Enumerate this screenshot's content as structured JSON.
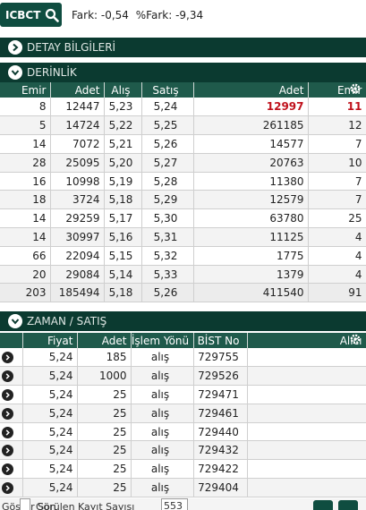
{
  "toolbar": {
    "symbol": "ICBCT",
    "fark": "Fark: -0,54",
    "pct_fark": "%Fark: -9,34"
  },
  "panels": {
    "detay": "DETAY BİLGİLERİ",
    "derinlik": "DERİNLİK",
    "zaman": "ZAMAN / SATIŞ"
  },
  "depth": {
    "headers": [
      "Emir",
      "Adet",
      "Alış",
      "Satış",
      "Adet",
      "Emir"
    ],
    "rows": [
      [
        "8",
        "12447",
        "5,23",
        "5,24",
        "12997",
        "11"
      ],
      [
        "5",
        "14724",
        "5,22",
        "5,25",
        "261185",
        "12"
      ],
      [
        "14",
        "7072",
        "5,21",
        "5,26",
        "14577",
        "7"
      ],
      [
        "28",
        "25095",
        "5,20",
        "5,27",
        "20763",
        "10"
      ],
      [
        "16",
        "10998",
        "5,19",
        "5,28",
        "11380",
        "7"
      ],
      [
        "18",
        "3724",
        "5,18",
        "5,29",
        "12579",
        "7"
      ],
      [
        "14",
        "29259",
        "5,17",
        "5,30",
        "63780",
        "25"
      ],
      [
        "14",
        "30997",
        "5,16",
        "5,31",
        "11125",
        "4"
      ],
      [
        "66",
        "22094",
        "5,15",
        "5,32",
        "1775",
        "4"
      ],
      [
        "20",
        "29084",
        "5,14",
        "5,33",
        "1379",
        "4"
      ]
    ],
    "total": [
      "203",
      "185494",
      "5,18",
      "5,26",
      "411540",
      "91"
    ]
  },
  "trades": {
    "headers": [
      "",
      "Fiyat",
      "Adet",
      "İşlem Yönü",
      "BİST No",
      "Alıcı"
    ],
    "rows": [
      [
        "5,24",
        "185",
        "alış",
        "729755"
      ],
      [
        "5,24",
        "1000",
        "alış",
        "729526"
      ],
      [
        "5,24",
        "25",
        "alış",
        "729471"
      ],
      [
        "5,24",
        "25",
        "alış",
        "729461"
      ],
      [
        "5,24",
        "25",
        "alış",
        "729440"
      ],
      [
        "5,24",
        "25",
        "alış",
        "729432"
      ],
      [
        "5,24",
        "25",
        "alış",
        "729422"
      ],
      [
        "5,24",
        "25",
        "alış",
        "729404"
      ]
    ]
  },
  "footer": {
    "text": "Göster Son",
    "label": "Görülen Kayıt Sayısı",
    "count": "553"
  },
  "colors": {
    "brand": "#0f4d40",
    "header": "#1f5a4b",
    "highlight": "#c0121d"
  },
  "icons": [
    "search-icon",
    "chevron-right-icon",
    "chevron-down-icon",
    "gear-icon",
    "arrow-right-icon"
  ]
}
